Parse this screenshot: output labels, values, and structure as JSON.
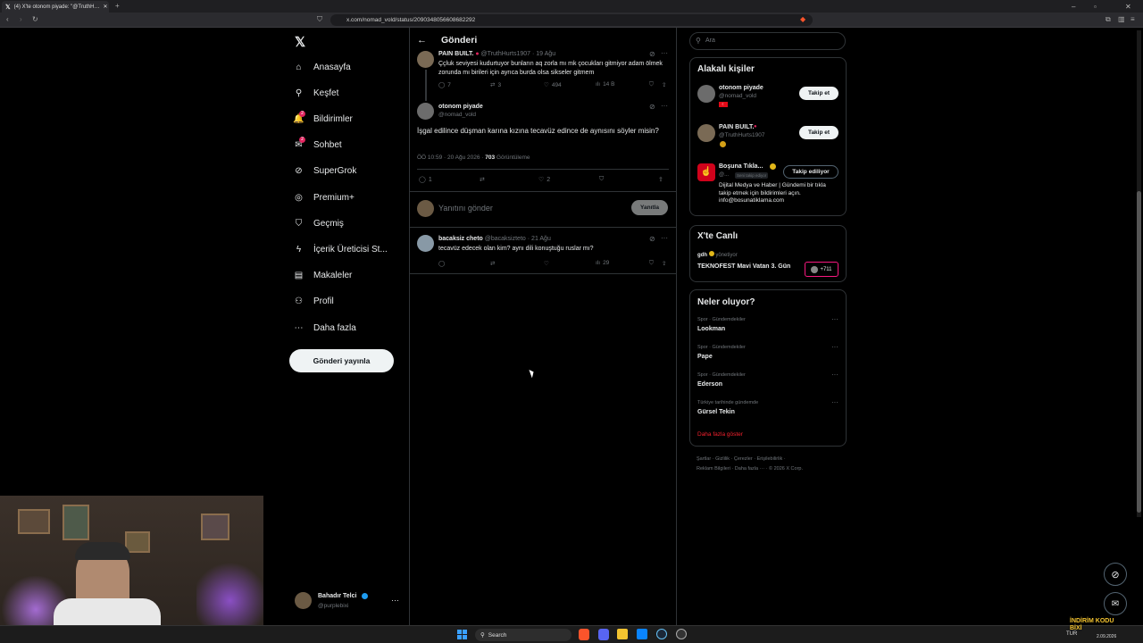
{
  "browser": {
    "tab_title": "(4) X'te otonom piyade: \"@TruthH…",
    "url": "x.com/nomad_vold/status/2090348056608682292",
    "window_controls": [
      "minimize",
      "maximize",
      "close"
    ]
  },
  "nav": {
    "items": [
      {
        "label": "Anasayfa",
        "icon": "home-icon"
      },
      {
        "label": "Keşfet",
        "icon": "search-icon"
      },
      {
        "label": "Bildirimler",
        "icon": "bell-icon",
        "badge": "2"
      },
      {
        "label": "Sohbet",
        "icon": "chat-icon",
        "badge": "2"
      },
      {
        "label": "SuperGrok",
        "icon": "grok-icon"
      },
      {
        "label": "Premium+",
        "icon": "premium-icon"
      },
      {
        "label": "Geçmiş",
        "icon": "bookmark-icon"
      },
      {
        "label": "İçerik Üreticisi St...",
        "icon": "lightning-icon"
      },
      {
        "label": "Makaleler",
        "icon": "article-icon"
      },
      {
        "label": "Profil",
        "icon": "profile-icon"
      },
      {
        "label": "Daha fazla",
        "icon": "more-icon"
      }
    ],
    "post_button": "Gönderi yayınla",
    "account": {
      "name": "Bahadır Telci",
      "handle": "@purplebixi"
    }
  },
  "center": {
    "header_title": "Gönderi",
    "parent_post": {
      "name": "PAIN BUILT.",
      "handle": "@TruthHurts1907",
      "time": "19 Ağu",
      "text": "Ççluk seviyesi kudurtuyor bunların aq zorla mı mk çocukları gitmiyor adam ölmek zorunda mı birileri için ayrıca burda olsa sikseler gitmem",
      "replies": "7",
      "reposts": "3",
      "likes": "494",
      "views": "14 B"
    },
    "main_post": {
      "name": "otonom piyade",
      "handle": "@nomad_vold",
      "text": "İşgal edilince düşman karına kızına tecavüz edince de aynısını söyler misin?",
      "timestamp": "ÖÖ 10:59 · 20 Ağu 2026 ·",
      "views_count": "703",
      "views_label": "Görüntüleme",
      "replies": "1",
      "likes": "2"
    },
    "reply_box": {
      "placeholder": "Yanıtını gönder",
      "button": "Yanıtla"
    },
    "reply_post": {
      "name": "bacaksiz cheto",
      "handle": "@bacaksizteto",
      "time": "21 Ağu",
      "text": "tecavüz edecek olan kim? aynı dili konuştuğu ruslar mı?",
      "views": "29"
    }
  },
  "right": {
    "search_placeholder": "Ara",
    "related": {
      "title": "Alakalı kişiler",
      "people": [
        {
          "name": "otonom piyade",
          "handle": "@nomad_vold",
          "button": "Takip et"
        },
        {
          "name": "PAIN BUILT.",
          "handle": "@TruthHurts1907",
          "button": "Takip et"
        },
        {
          "name": "Boşuna Tıkla...",
          "handle": "@...",
          "follows_you": "Seni takip ediyor",
          "button": "Takip ediliyor",
          "bio": "Dijital Medya ve Haber | Gündemi bir tıkla takip etmek için bildirimleri açın. info@bosunatiklama.com"
        }
      ]
    },
    "live": {
      "title": "X'te Canlı",
      "host": "gdh",
      "host_status": "yönetiyor",
      "event": "TEKNOFEST Mavi Vatan 3. Gün",
      "count": "+711"
    },
    "trends": {
      "title": "Neler oluyor?",
      "items": [
        {
          "category": "Spor · Gündemdekiler",
          "name": "Lookman"
        },
        {
          "category": "Spor · Gündemdekiler",
          "name": "Pape"
        },
        {
          "category": "Spor · Gündemdekiler",
          "name": "Ederson"
        },
        {
          "category": "Türkiye tarihinde gündemde",
          "name": "Gürsel Tekin"
        }
      ],
      "show_more": "Daha fazla göster"
    },
    "footer": {
      "links": [
        "Şartlar",
        "Gizlilik",
        "Çerezler",
        "Erişilebilirlik",
        "Reklam Bilgileri",
        "Daha fazla ···",
        "© 2026 X Corp."
      ]
    }
  },
  "taskbar": {
    "search_label": "Search",
    "lang": "TUR",
    "date": "2.09.2026"
  },
  "overlay": {
    "brand": "İNDİRİM KODU BİXİ"
  },
  "colors": {
    "accent": "#1d9bf0",
    "like": "#f91880",
    "verified": "#e2b719",
    "badge": "#e0245e",
    "red_link": "#f4212e"
  }
}
